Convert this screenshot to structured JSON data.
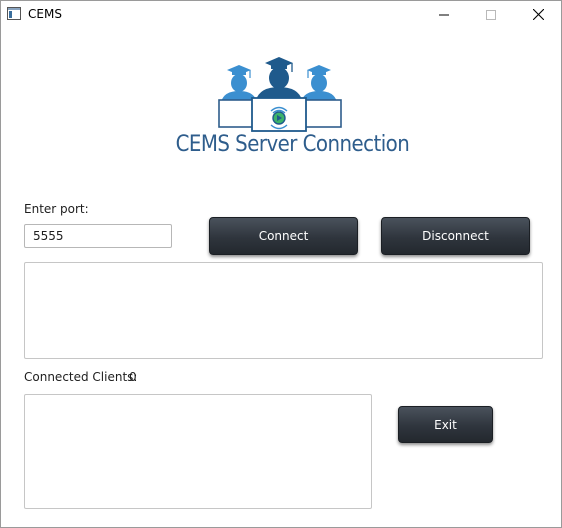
{
  "window": {
    "title": "CEMS",
    "controls": {
      "minimize": "minimize",
      "maximize": "maximize",
      "close": "close"
    }
  },
  "logo": {
    "text": "CEMS Server Connection",
    "accent_color": "#2e5d8c"
  },
  "port": {
    "label": "Enter port:",
    "value": "5555",
    "placeholder": ""
  },
  "buttons": {
    "connect": "Connect",
    "disconnect": "Disconnect",
    "exit": "Exit"
  },
  "log": {
    "content": ""
  },
  "clients": {
    "label": "Connected Clients:",
    "count": "0",
    "list_content": ""
  },
  "colors": {
    "button_dark": "#2f353d",
    "logo_blue": "#2e5d8c",
    "logo_light_blue": "#3b8fd0"
  }
}
